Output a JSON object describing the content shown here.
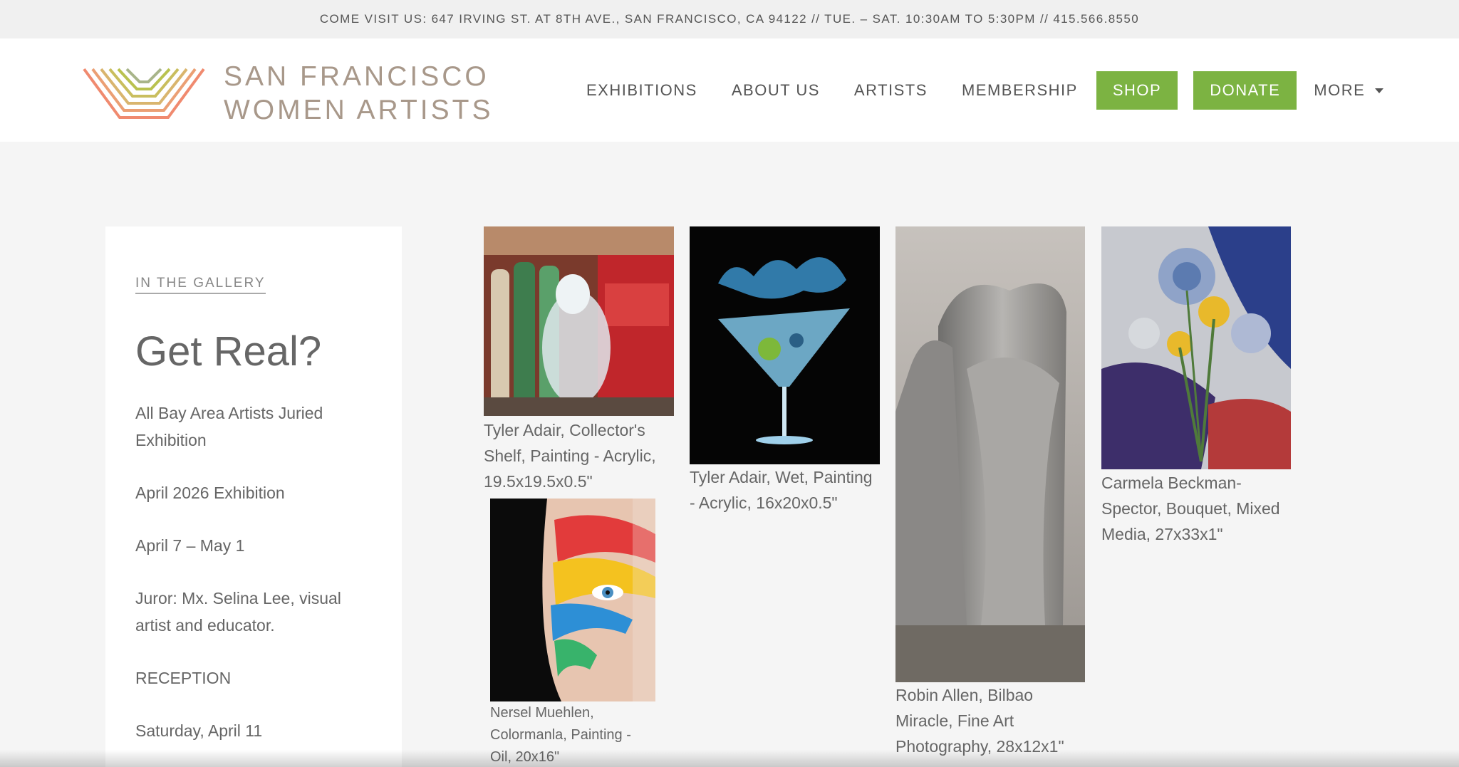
{
  "topbar": {
    "text": "COME VISIT US: 647 IRVING ST. AT 8TH AVE., SAN FRANCISCO, CA 94122 // TUE. – SAT. 10:30AM TO 5:30PM // 415.566.8550"
  },
  "logo": {
    "line1": "SAN FRANCISCO",
    "line2": "WOMEN ARTISTS"
  },
  "nav": {
    "exhibitions": "EXHIBITIONS",
    "about": "ABOUT US",
    "artists": "ARTISTS",
    "membership": "MEMBERSHIP",
    "shop": "SHOP",
    "donate": "DONATE",
    "more": "MORE"
  },
  "colors": {
    "accent_green": "#7cb342",
    "logo_taupe": "#a8988a"
  },
  "gallery": {
    "eyebrow": "IN THE GALLERY",
    "title": "Get Real?",
    "subtitle": "All Bay Area Artists Juried Exhibition",
    "exhibition": "April 2026 Exhibition",
    "dates": "April 7 – May 1",
    "juror": "Juror: Mx. Selina Lee, visual artist and educator.",
    "reception_label": "RECEPTION",
    "reception_date": "Saturday, April 11"
  },
  "artworks": [
    {
      "caption": "Tyler Adair, Collector's Shelf, Painting - Acrylic, 19.5x19.5x0.5\""
    },
    {
      "caption": "Tyler Adair, Wet, Painting - Acrylic, 16x20x0.5\""
    },
    {
      "caption": "Robin Allen, Bilbao Miracle, Fine Art Photography, 28x12x1\""
    },
    {
      "caption": "Carmela Beckman-Spector, Bouquet, Mixed Media, 27x33x1\""
    },
    {
      "caption": "Nersel Muehlen, Colormanla, Painting - Oil, 20x16\""
    }
  ]
}
